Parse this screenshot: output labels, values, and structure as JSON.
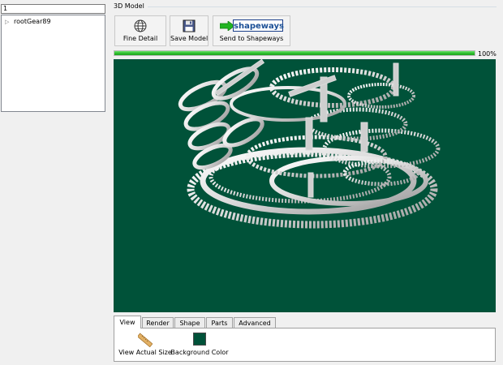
{
  "search": {
    "value": "1"
  },
  "tree": {
    "items": [
      {
        "label": "rootGear89",
        "expanded": false
      }
    ]
  },
  "panel": {
    "title": "3D Model"
  },
  "toolbar": {
    "buttons": [
      {
        "label": "Fine Detail",
        "icon": "globe-icon"
      },
      {
        "label": "Save Model",
        "icon": "floppy-disk-icon"
      },
      {
        "label": "Send to Shapeways",
        "icon": "shapeways-logo",
        "logo_text": "shapeways"
      }
    ]
  },
  "progress": {
    "text": "100%",
    "value": 1.0
  },
  "viewport": {
    "background_color": "#005239",
    "model": "clock gear assembly"
  },
  "tabs": [
    {
      "label": "View",
      "active": true
    },
    {
      "label": "Render",
      "active": false
    },
    {
      "label": "Shape",
      "active": false
    },
    {
      "label": "Parts",
      "active": false
    },
    {
      "label": "Advanced",
      "active": false
    }
  ],
  "view_tab": {
    "actual_size_label": "View Actual Size",
    "actual_size_icon": "ruler-icon",
    "bg_color_label": "Background Color",
    "bg_color": "#005239"
  },
  "colors": {
    "progress": "#2fbf2f",
    "shapeways_blue": "#1b4f96",
    "shapeways_arrow": "#22b422"
  }
}
